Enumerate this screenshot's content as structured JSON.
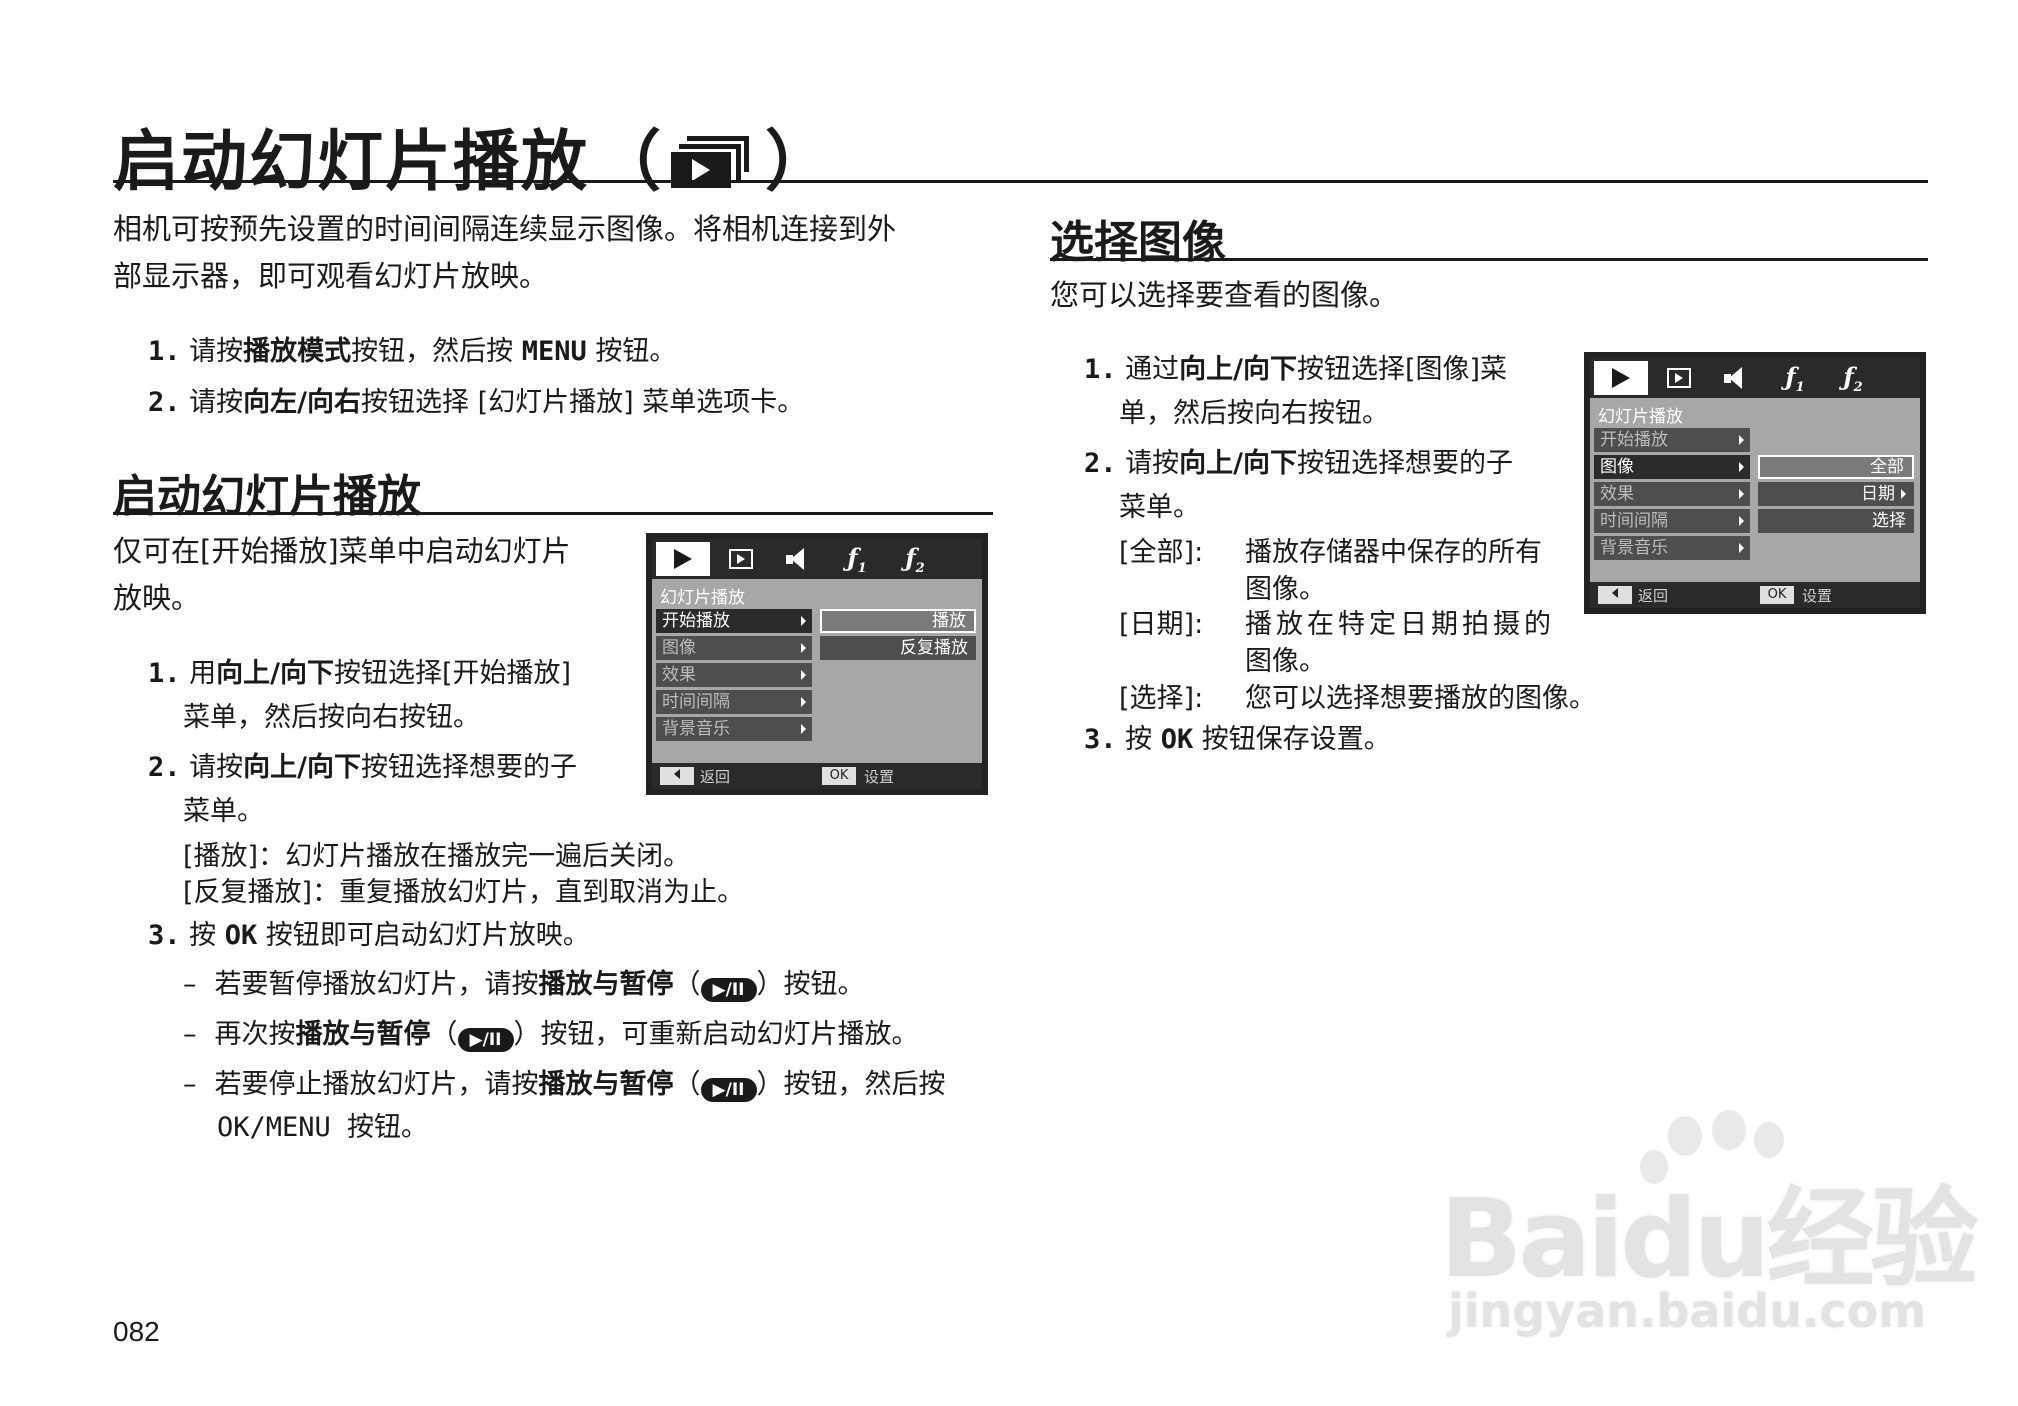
{
  "page": {
    "title": "启动幻灯片播放",
    "title_icon": "slideshow-icon",
    "page_number": "082"
  },
  "intro": {
    "line1": "相机可按预先设置的时间间隔连续显示图像。将相机连接到外",
    "line2": "部显示器，即可观看幻灯片放映。",
    "steps": [
      {
        "num": "1.",
        "pre": "请按",
        "bold": "播放模式",
        "mid": "按钮，然后按 ",
        "key": "MENU",
        "post": " 按钮。"
      },
      {
        "num": "2.",
        "pre": "请按",
        "bold": "向左/向右",
        "post": "按钮选择 [幻灯片播放] 菜单选项卡。"
      }
    ]
  },
  "start_section": {
    "heading": "启动幻灯片播放",
    "lead1": "仅可在[开始播放]菜单中启动幻灯片",
    "lead2": "放映。",
    "step1": {
      "num": "1.",
      "pre": "用",
      "bold": "向上/向下",
      "post": "按钮选择[开始播放]",
      "cont": "菜单，然后按向右按钮。"
    },
    "step2": {
      "num": "2.",
      "pre": "请按",
      "bold": "向上/向下",
      "post": "按钮选择想要的子",
      "cont": "菜单。"
    },
    "opt1": "[播放]：幻灯片播放在播放完一遍后关闭。",
    "opt2": "[反复播放]：重复播放幻灯片，直到取消为止。",
    "step3": {
      "num": "3.",
      "pre": "按 ",
      "key": "OK",
      "post": " 按钮即可启动幻灯片放映。"
    },
    "dash1": {
      "pre": "若要暂停播放幻灯片，请按",
      "bold": "播放与暂停",
      "open": "（",
      "close": "）按钮。"
    },
    "dash2": {
      "pre": "再次按",
      "bold": "播放与暂停",
      "open": "（",
      "close": "）按钮，可重新启动幻灯片播放。"
    },
    "dash3": {
      "pre": "若要停止播放幻灯片，请按",
      "bold": "播放与暂停",
      "open": "（",
      "close": "）按钮，然后按",
      "cont": "OK/MENU 按钮。"
    },
    "pause_icon_text": "▶/II"
  },
  "select_section": {
    "heading": "选择图像",
    "lead": "您可以选择要查看的图像。",
    "step1": {
      "num": "1.",
      "pre": "通过",
      "bold": "向上/向下",
      "post": "按钮选择[图像]菜",
      "cont": "单，然后按向右按钮。"
    },
    "step2": {
      "num": "2.",
      "pre": "请按",
      "bold": "向上/向下",
      "post": "按钮选择想要的子",
      "cont": "菜单。"
    },
    "opt_all_label": "[全部]:",
    "opt_all_text": "播放存储器中保存的所有",
    "opt_all_cont": "图像。",
    "opt_date_label": "[日期]:",
    "opt_date_text": "播放在特定日期拍摄的",
    "opt_date_cont": "图像。",
    "opt_sel_label": "[选择]:",
    "opt_sel_text": "您可以选择想要播放的图像。",
    "step3": {
      "num": "3.",
      "pre": "按 ",
      "key": "OK",
      "post": " 按钮保存设置。"
    }
  },
  "lcd": {
    "menu_title": "幻灯片播放",
    "menu_items": [
      "开始播放",
      "图像",
      "效果",
      "时间间隔",
      "背景音乐"
    ],
    "tab_wrench1": "ƒ",
    "tab_wrench1_sub": "1",
    "tab_wrench2": "ƒ",
    "tab_wrench2_sub": "2",
    "back_label": "返回",
    "ok_key": "OK",
    "ok_label": "设置",
    "screen1_options": [
      "播放",
      "反复播放"
    ],
    "screen2_options": [
      "全部",
      "日期",
      "选择"
    ]
  },
  "watermark": {
    "logo": "Baidu经验",
    "url": "jingyan.baidu.com"
  }
}
